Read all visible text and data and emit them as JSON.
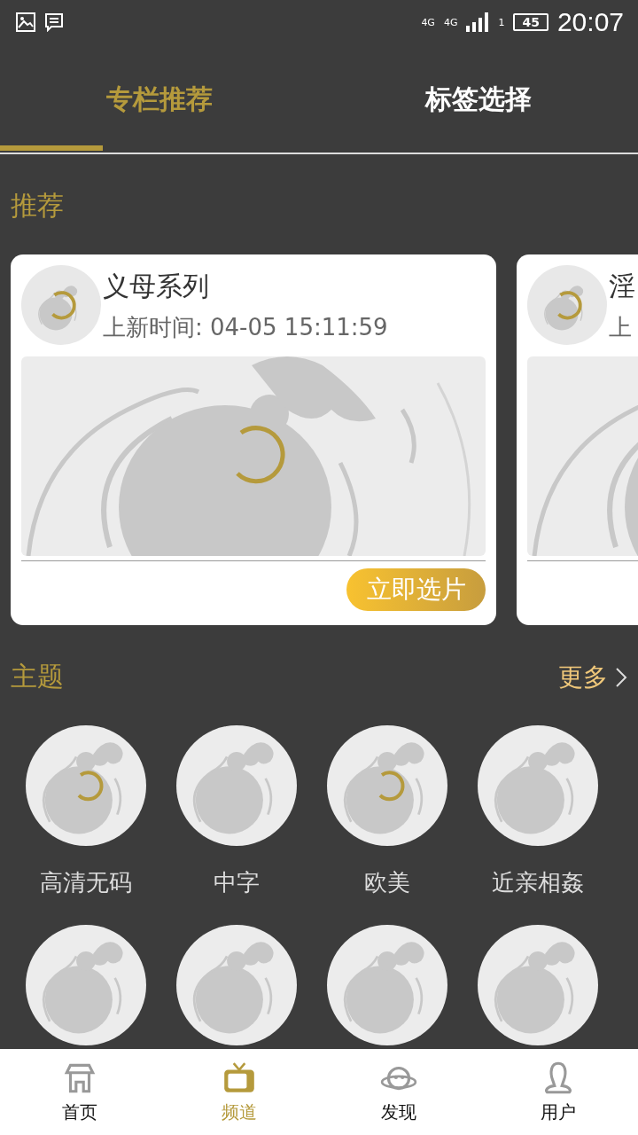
{
  "status_bar": {
    "network_1": "4G",
    "network_2": "4G",
    "sim": "1",
    "battery": "45",
    "time": "20:07"
  },
  "tabs": [
    {
      "label": "专栏推荐",
      "selected": true
    },
    {
      "label": "标签选择",
      "selected": false
    }
  ],
  "recommend": {
    "title": "推荐",
    "cards": [
      {
        "title": "义母系列",
        "subtitle": "上新时间: 04-05 15:11:59",
        "avatar_loading": true,
        "image_loading": true,
        "button": "立即选片"
      },
      {
        "title": "淫",
        "subtitle": "上",
        "avatar_loading": true,
        "image_loading": false
      }
    ]
  },
  "topics": {
    "title": "主题",
    "more": "更多",
    "items": [
      {
        "label": "高清无码",
        "loading": true
      },
      {
        "label": "中字",
        "loading": false
      },
      {
        "label": "欧美",
        "loading": true
      },
      {
        "label": "近亲相姦",
        "loading": false
      },
      {
        "loading": false
      },
      {
        "loading": false
      },
      {
        "loading": false
      },
      {
        "loading": false
      }
    ]
  },
  "nav": [
    {
      "label": "首页",
      "selected": false
    },
    {
      "label": "频道",
      "selected": true
    },
    {
      "label": "发现",
      "selected": false
    },
    {
      "label": "用户",
      "selected": false
    }
  ]
}
